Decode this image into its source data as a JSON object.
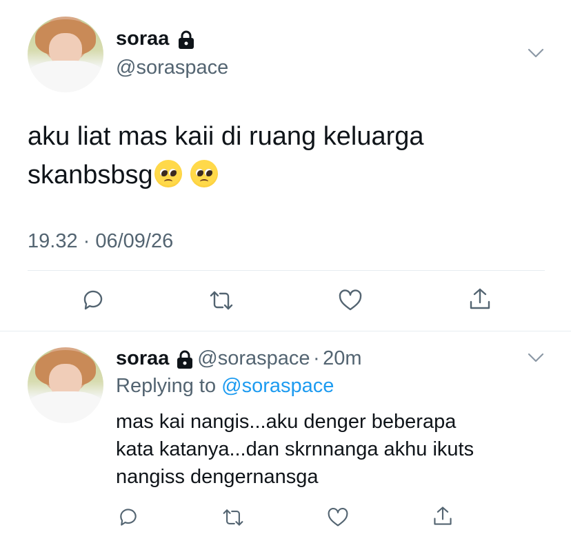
{
  "main_tweet": {
    "display_name": "soraa",
    "handle": "@soraspace",
    "text_line1": "aku liat mas kaii di ruang keluarga",
    "text_line2": "skanbsbsg",
    "emojis": [
      "pleading-face",
      "pleading-face"
    ],
    "timestamp": "19.32 · 06/09/26",
    "actions": [
      "reply-icon",
      "retweet-icon",
      "like-icon",
      "share-icon"
    ]
  },
  "reply_tweet": {
    "display_name": "soraa",
    "handle": "@soraspace",
    "separator": "·",
    "age": "20m",
    "replying_prefix": "Replying to",
    "replying_to": "@soraspace",
    "text_lines": [
      "mas kai nangis...aku denger beberapa",
      "kata katanya...dan skrnnanga akhu ikuts",
      "nangiss dengernansga"
    ],
    "actions": [
      "reply-icon",
      "retweet-icon",
      "like-icon",
      "share-icon"
    ]
  },
  "colors": {
    "text": "#0f1419",
    "secondary": "#536471",
    "link": "#1d9bf0",
    "divider": "#e6ecf0"
  }
}
